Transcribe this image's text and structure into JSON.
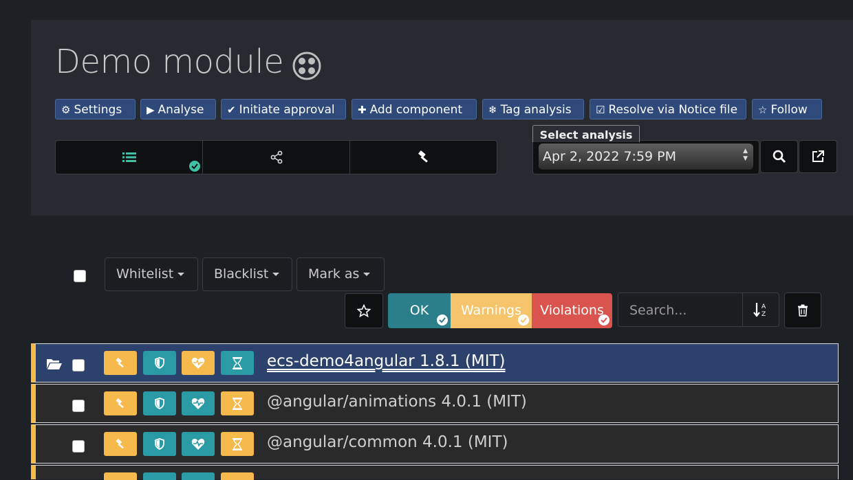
{
  "header": {
    "title": "Demo module",
    "title_icon": "brain-icon"
  },
  "toolbar": {
    "buttons": [
      {
        "label": "Settings",
        "icon": "cogs-icon"
      },
      {
        "label": "Analyse",
        "icon": "play-icon"
      },
      {
        "label": "Initiate approval",
        "icon": "check-circle-icon"
      },
      {
        "label": "Add component",
        "icon": "puzzle-icon"
      },
      {
        "label": "Tag analysis",
        "icon": "snowflake-icon"
      },
      {
        "label": "Resolve via Notice file",
        "icon": "check-square-icon"
      },
      {
        "label": "Follow",
        "icon": "star-icon"
      }
    ]
  },
  "view_tabs": [
    {
      "icon": "list-icon",
      "status": "ok"
    },
    {
      "icon": "share-nodes-icon"
    },
    {
      "icon": "gavel-icon"
    }
  ],
  "analysis_select": {
    "label": "Select analysis",
    "value": "Apr 2, 2022 7:59 PM"
  },
  "list_controls": {
    "dropdowns": [
      "Whitelist",
      "Blacklist",
      "Mark as"
    ],
    "filters": [
      {
        "label": "OK",
        "color": "#2a7f8a",
        "checked": true
      },
      {
        "label": "Warnings",
        "color": "#f6c46a",
        "checked": true
      },
      {
        "label": "Violations",
        "color": "#d9534f",
        "checked": true
      }
    ],
    "search_placeholder": "Search..."
  },
  "rows": [
    {
      "name": "ecs-demo4angular 1.8.1 (MIT)",
      "selected": true,
      "folder": true
    },
    {
      "name": "@angular/animations 4.0.1 (MIT)",
      "selected": false,
      "folder": false
    },
    {
      "name": "@angular/common 4.0.1 (MIT)",
      "selected": false,
      "folder": false
    }
  ],
  "colors": {
    "accent_blue": "#2f4a7a",
    "ok_teal": "#2a7f8a",
    "warning_orange": "#f6b94b",
    "violation_red": "#d9534f"
  }
}
